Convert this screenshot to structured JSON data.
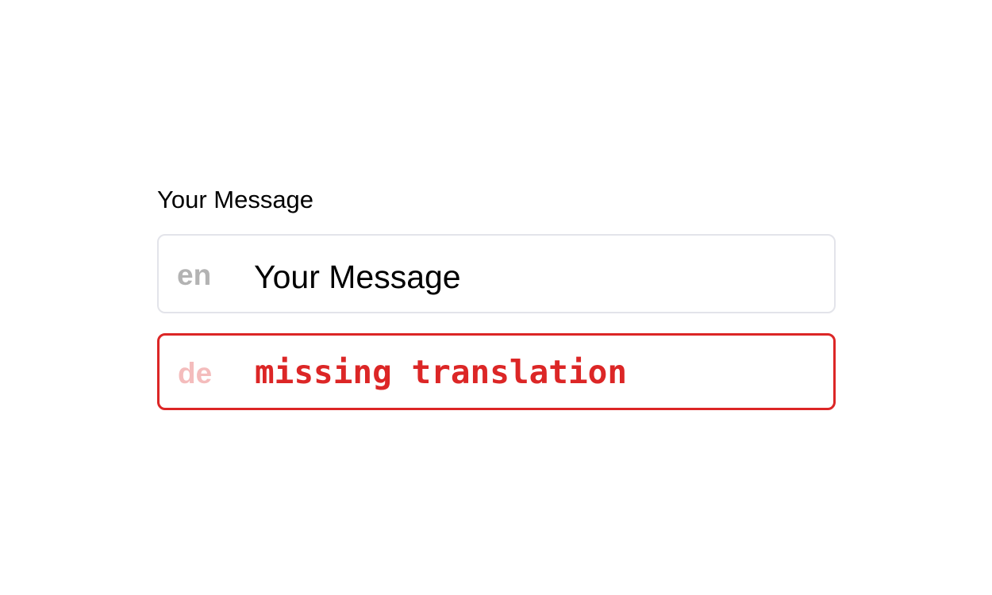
{
  "field": {
    "label": "Your Message"
  },
  "translations": [
    {
      "lang": "en",
      "value": "Your Message",
      "status": "ok"
    },
    {
      "lang": "de",
      "value": "missing translation",
      "status": "missing"
    }
  ],
  "colors": {
    "error": "#dc2626",
    "border": "#e3e4ea",
    "lang_muted": "#b3b3b3",
    "lang_error_muted": "#f4bcbc"
  }
}
